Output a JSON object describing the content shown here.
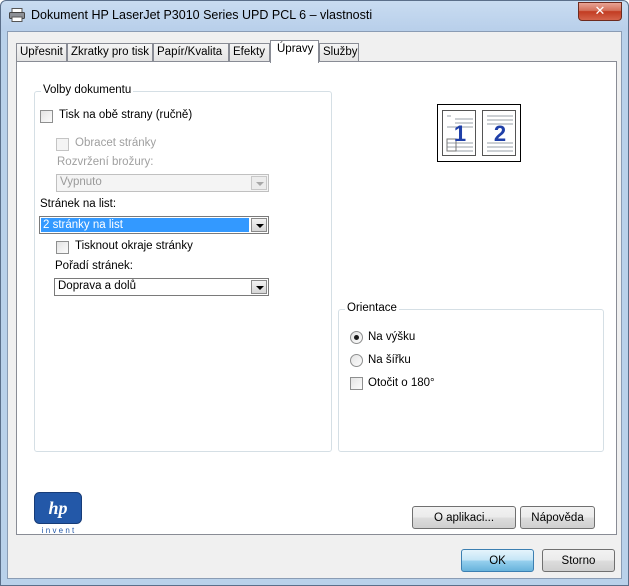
{
  "window": {
    "title": "Dokument HP LaserJet P3010 Series UPD PCL 6 – vlastnosti",
    "close_label": "✕"
  },
  "tabs": [
    {
      "label": "Upřesnit"
    },
    {
      "label": "Zkratky pro tisk"
    },
    {
      "label": "Papír/Kvalita"
    },
    {
      "label": "Efekty"
    },
    {
      "label": "Úpravy",
      "active": true
    },
    {
      "label": "Služby"
    }
  ],
  "document_options": {
    "legend": "Volby dokumentu",
    "duplex_label": "Tisk na obě strany (ručně)",
    "flip_pages_label": "Obracet stránky",
    "booklet_layout_label": "Rozvržení brožury:",
    "booklet_layout_value": "Vypnuto",
    "pages_per_sheet_label": "Stránek na list:",
    "pages_per_sheet_value": "2 stránky na list",
    "print_borders_label": "Tisknout okraje stránky",
    "page_order_label": "Pořadí stránek:",
    "page_order_value": "Doprava a dolů"
  },
  "preview": {
    "page1": "1",
    "page2": "2"
  },
  "orientation": {
    "legend": "Orientace",
    "portrait_label": "Na výšku",
    "landscape_label": "Na šířku",
    "rotate_label": "Otočit o 180°",
    "selected": "portrait"
  },
  "logo": {
    "brand": "hp",
    "tagline": "i n v e n t"
  },
  "buttons": {
    "about": "O aplikaci...",
    "help": "Nápověda",
    "ok": "OK",
    "cancel": "Storno"
  }
}
